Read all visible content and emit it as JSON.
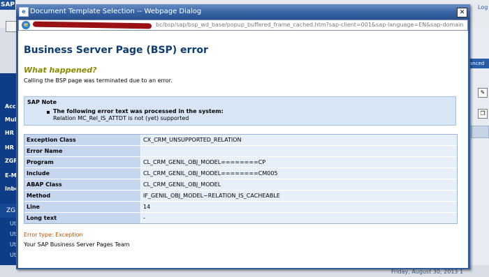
{
  "background": {
    "logo": "SAP",
    "top_link": "Log",
    "left_nav": [
      "Acc",
      "Mul",
      "HR S",
      "HR M",
      "ZGP",
      "E-M",
      "Inbo"
    ],
    "left_nav_selected": "ZG",
    "left_nav_sub": [
      "Ut",
      "Ut",
      "Ut",
      "Ut"
    ],
    "right_tab": "anced",
    "status_text": "Friday, August 30, 2013 1"
  },
  "dialog": {
    "title": "Document Template Selection -- Webpage Dialog",
    "close_glyph": "✕",
    "url": "bc/bsp/sap/bsp_wd_base/popup_buffered_frame_cached.htm?sap-client=001&sap-language=EN&sap-domainRelax=min"
  },
  "error_page": {
    "title": "Business Server Page (BSP) error",
    "what_happened_heading": "What happened?",
    "what_happened_text": "Calling the BSP page was terminated due to an error.",
    "sap_note": {
      "heading": "SAP Note",
      "line1": "The following error text was processed in the system:",
      "line2": "Relation MC_Rel_IS_ATTDT is not (yet) supported"
    },
    "details": [
      {
        "label": "Exception Class",
        "value": "CX_CRM_UNSUPPORTED_RELATION"
      },
      {
        "label": "Error Name",
        "value": ""
      },
      {
        "label": "Program",
        "value": "CL_CRM_GENIL_OBJ_MODEL========CP"
      },
      {
        "label": "Include",
        "value": "CL_CRM_GENIL_OBJ_MODEL========CM005"
      },
      {
        "label": "ABAP Class",
        "value": "CL_CRM_GENIL_OBJ_MODEL"
      },
      {
        "label": "Method",
        "value": "IF_GENIL_OBJ_MODEL~RELATION_IS_CACHEABLE"
      },
      {
        "label": "Line",
        "value": "14"
      },
      {
        "label": "Long text",
        "value": "-"
      }
    ],
    "error_type": "Error type: Exception",
    "signature": "Your SAP Business Server Pages Team"
  },
  "icons": {
    "dialog": "ie-page-icon",
    "address": "ie-icon",
    "close": "close-icon"
  },
  "colors": {
    "title_blue": "#0d3b73",
    "heading_olive": "#8a8a00",
    "error_orange": "#c05000",
    "note_bg": "#d7e5f7"
  }
}
